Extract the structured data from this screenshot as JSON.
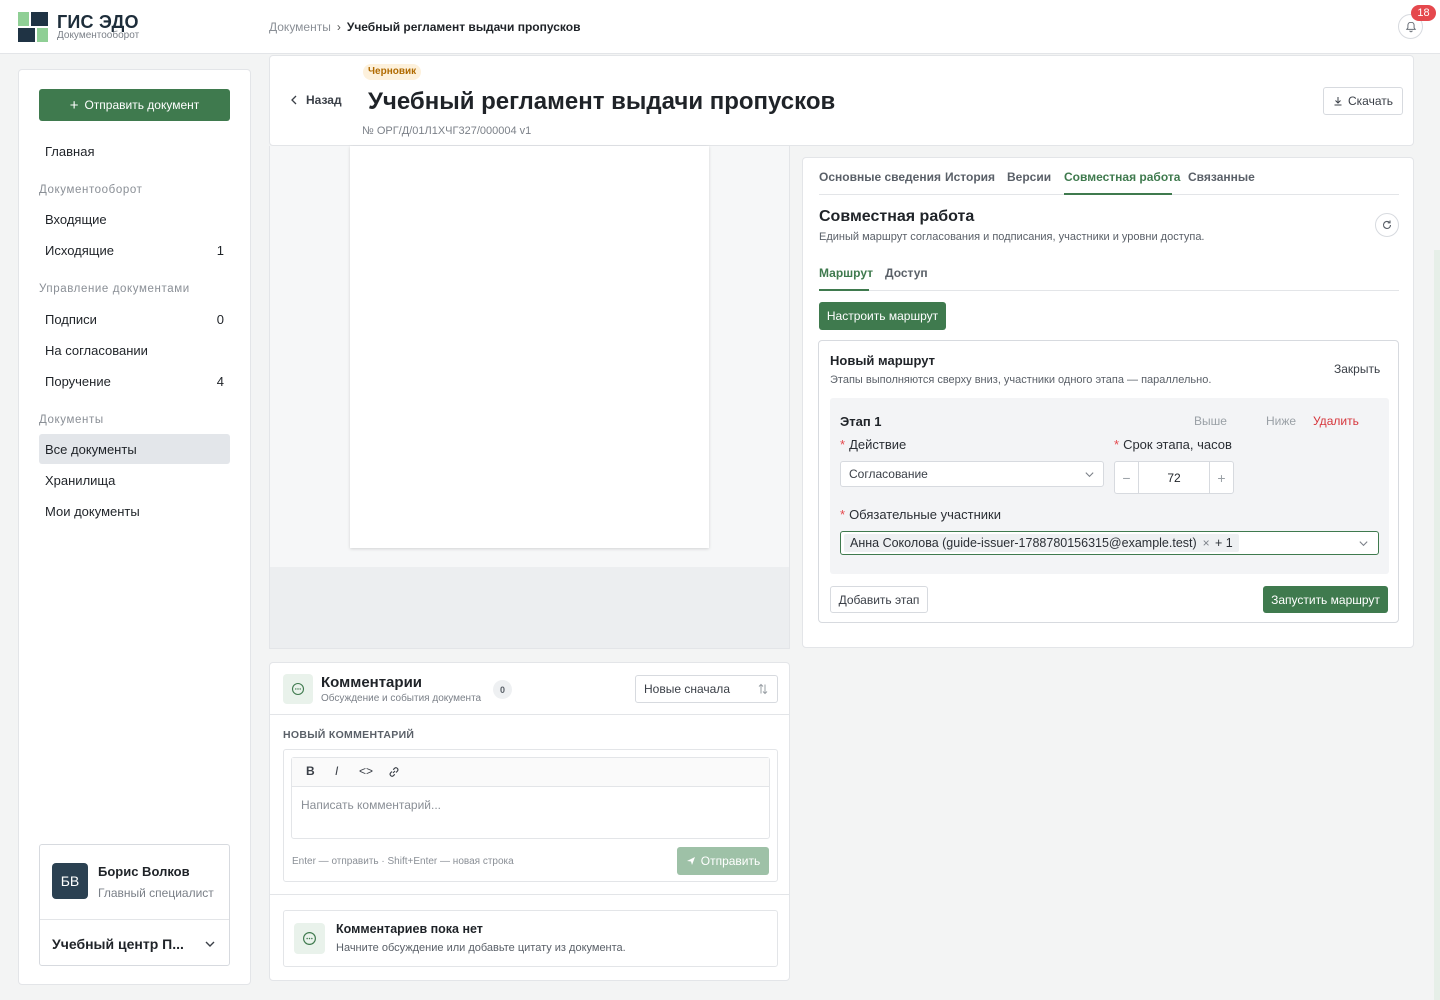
{
  "app": {
    "title": "ГИС ЭДО",
    "subtitle": "Документооборот"
  },
  "breadcrumb": {
    "parent": "Документы",
    "separator": "›",
    "current": "Учебный регламент выдачи пропусков"
  },
  "notifications": {
    "count": "18"
  },
  "colors": {
    "accent": "#3f7a4e",
    "danger": "#e5484d",
    "draft_bg": "#fdf1dc"
  },
  "sidebar": {
    "send_button": "Отправить документ",
    "home": "Главная",
    "sections": [
      {
        "title": "Документооборот",
        "items": [
          {
            "label": "Входящие",
            "count": ""
          },
          {
            "label": "Исходящие",
            "count": "1"
          }
        ]
      },
      {
        "title": "Управление документами",
        "items": [
          {
            "label": "Подписи",
            "count": "0"
          },
          {
            "label": "На согласовании",
            "count": ""
          },
          {
            "label": "Поручение",
            "count": "4"
          }
        ]
      },
      {
        "title": "Документы",
        "items": [
          {
            "label": "Все документы",
            "count": ""
          },
          {
            "label": "Хранилища",
            "count": ""
          },
          {
            "label": "Мои документы",
            "count": ""
          }
        ]
      }
    ],
    "user": {
      "initials": "БВ",
      "name": "Борис Волков",
      "role": "Главный специалист",
      "org": "Учебный центр П..."
    }
  },
  "document": {
    "status": "Черновик",
    "back": "Назад",
    "title": "Учебный регламент выдачи пропусков",
    "number": "№ ОРГ/Д/01Л1ХЧГ327/000004  v1",
    "download": "Скачать"
  },
  "tabs": [
    "Основные сведения",
    "История",
    "Версии",
    "Совместная работа",
    "Связанные"
  ],
  "collab": {
    "title": "Совместная работа",
    "subtitle": "Единый маршрут согласования и подписания, участники и уровни доступа.",
    "subtabs": [
      "Маршрут",
      "Доступ"
    ],
    "configure_button": "Настроить маршрут",
    "route": {
      "title": "Новый маршрут",
      "subtitle": "Этапы выполняются сверху вниз, участники одного этапа — параллельно.",
      "close": "Закрыть",
      "stage": {
        "title": "Этап 1",
        "up": "Выше",
        "down": "Ниже",
        "delete": "Удалить",
        "action_label": "Действие",
        "action_value": "Согласование",
        "deadline_label": "Срок этапа, часов",
        "deadline_value": "72",
        "minus": "−",
        "plus": "+",
        "participants_label": "Обязательные участники",
        "participant": "Анна Соколова (guide-issuer-1788780156315@example.test)",
        "more": "+ 1"
      },
      "add_stage": "Добавить этап",
      "run": "Запустить маршрут"
    }
  },
  "comments": {
    "title": "Комментарии",
    "subtitle": "Обсуждение и события документа",
    "count": "0",
    "sort": "Новые сначала",
    "new_label": "НОВЫЙ КОММЕНТАРИЙ",
    "toolbar": {
      "bold": "B",
      "italic": "I",
      "code": "<>"
    },
    "placeholder": "Написать комментарий...",
    "hint": "Enter — отправить · Shift+Enter — новая строка",
    "send": "Отправить",
    "empty_title": "Комментариев пока нет",
    "empty_sub": "Начните обсуждение или добавьте цитату из документа."
  }
}
